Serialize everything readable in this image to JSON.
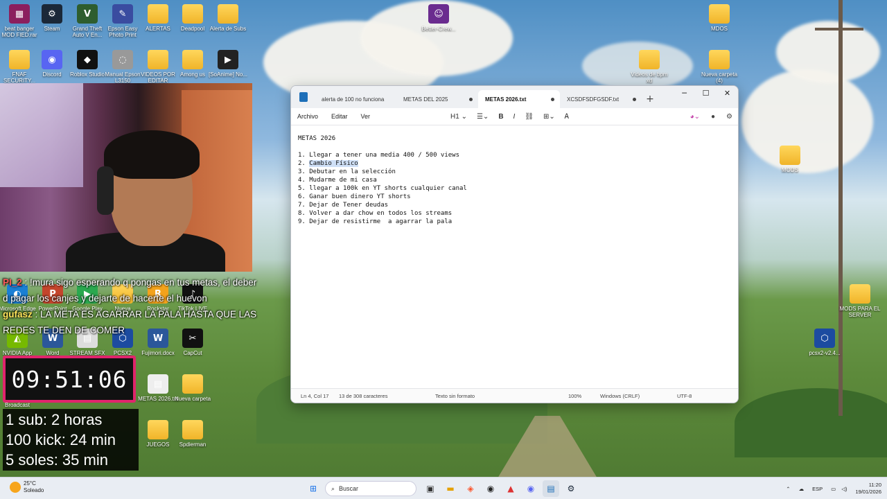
{
  "desktop_icons": [
    {
      "id": "beat-banger",
      "label": "beat banger MOD FIED.rar",
      "color": "#8b1f5e",
      "glyph": "▦"
    },
    {
      "id": "steam",
      "label": "Steam",
      "color": "#1b2838",
      "glyph": "⚙"
    },
    {
      "id": "gta",
      "label": "Grand Theft Auto V En...",
      "color": "#2e5d2e",
      "glyph": "V"
    },
    {
      "id": "epson",
      "label": "Epson Easy Photo Print",
      "color": "#3a4ca0",
      "glyph": "✎"
    },
    {
      "id": "alertas",
      "label": "ALERTAS",
      "color": "folder",
      "glyph": ""
    },
    {
      "id": "deadpool",
      "label": "Deadpool",
      "color": "folder",
      "glyph": ""
    },
    {
      "id": "alerta-subs",
      "label": "Alerta de Subs",
      "color": "folder",
      "glyph": ""
    },
    {
      "id": "better-crew",
      "label": "Better-Crew...",
      "color": "#6a2c8f",
      "glyph": "☺"
    },
    {
      "id": "mdos",
      "label": "MDOS",
      "color": "folder",
      "glyph": ""
    },
    {
      "id": "fnaf",
      "label": "FNAF SECURITY...",
      "color": "folder",
      "glyph": ""
    },
    {
      "id": "discord",
      "label": "Discord",
      "color": "#5865f2",
      "glyph": "◉"
    },
    {
      "id": "roblox",
      "label": "Roblox Studio",
      "color": "#111",
      "glyph": "◆"
    },
    {
      "id": "manual",
      "label": "Manual Epson L3150",
      "color": "#999",
      "glyph": "◌"
    },
    {
      "id": "videos-por-editar",
      "label": "VIDEOS POR EDITAR",
      "color": "folder",
      "glyph": ""
    },
    {
      "id": "among-us",
      "label": "Among us",
      "color": "folder",
      "glyph": ""
    },
    {
      "id": "soanime",
      "label": "[SoAnime] No...",
      "color": "#222",
      "glyph": "▶"
    },
    {
      "id": "videos-bpm",
      "label": "Videos de bpm xd",
      "color": "folder",
      "glyph": ""
    },
    {
      "id": "nueva-carpeta-4",
      "label": "Nueva carpeta (4)",
      "color": "folder",
      "glyph": ""
    },
    {
      "id": "mods",
      "label": "MODS",
      "color": "folder",
      "glyph": ""
    },
    {
      "id": "microsoft-edge",
      "label": "Microsoft Edge",
      "color": "#1a7fd4",
      "glyph": "◐"
    },
    {
      "id": "powerpoint",
      "label": "PowerPoint",
      "color": "#c4452c",
      "glyph": "P"
    },
    {
      "id": "google-play",
      "label": "Google Play",
      "color": "#2aa84f",
      "glyph": "▶"
    },
    {
      "id": "nueva",
      "label": "Nueva",
      "color": "folder",
      "glyph": ""
    },
    {
      "id": "rockstar",
      "label": "Rockstar",
      "color": "#f3a21b",
      "glyph": "R"
    },
    {
      "id": "tiktok-live",
      "label": "TikTok LIVE",
      "color": "#111",
      "glyph": "♪"
    },
    {
      "id": "mods-server",
      "label": "MODS PARA EL SERVER",
      "color": "folder",
      "glyph": ""
    },
    {
      "id": "nvidia-app",
      "label": "NVIDIA App",
      "color": "#76b900",
      "glyph": "◭"
    },
    {
      "id": "word",
      "label": "Word",
      "color": "#2b579a",
      "glyph": "W"
    },
    {
      "id": "stream-sfx",
      "label": "STREAM SFX",
      "color": "#ddd",
      "glyph": "▤"
    },
    {
      "id": "pcsx2",
      "label": "PCSX2",
      "color": "#1c4ba0",
      "glyph": "⬡"
    },
    {
      "id": "fujimori",
      "label": "Fujimori.docx",
      "color": "#2b579a",
      "glyph": "W"
    },
    {
      "id": "capcut",
      "label": "CapCut",
      "color": "#111",
      "glyph": "✂"
    },
    {
      "id": "pcsx2-v2",
      "label": "pcsx2-v2.4...",
      "color": "#1c4ba0",
      "glyph": "⬡"
    },
    {
      "id": "nvidia-broadcast",
      "label": "NVIDIA Broadcast",
      "color": "#76b900",
      "glyph": "◭"
    },
    {
      "id": "metas-2026",
      "label": "METAS 2026.txt",
      "color": "#eee",
      "glyph": "▤"
    },
    {
      "id": "nueva-carpeta",
      "label": "Nueva carpeta",
      "color": "folder",
      "glyph": ""
    },
    {
      "id": "juegos",
      "label": "JUEGOS",
      "color": "folder",
      "glyph": ""
    },
    {
      "id": "spdierman",
      "label": "Spdierman",
      "color": "folder",
      "glyph": ""
    }
  ],
  "chat": {
    "line1_user": "PI_2",
    "line1_text": "!mura sigo esperando q pongas en tus metas, el deber d pagar los canjes y dejarte de hacerte el huevon",
    "line2_user": "gufasz",
    "line2_text": "LA META ES AGARRAR LA PALA HASTA QUE LAS REDES TE DEN DE COMER"
  },
  "timer": {
    "value": "09:51:06"
  },
  "goals": [
    "1 sub: 2 horas",
    "100 kick: 24 min",
    "5 soles: 35 min"
  ],
  "notepad": {
    "tabs": [
      {
        "label": "alerta de 100 no funciona",
        "active": false
      },
      {
        "label": "METAS DEL 2025",
        "active": false
      },
      {
        "label": "METAS 2026.txt",
        "active": true
      },
      {
        "label": "XCSDFSDFGSDF.txt",
        "active": false
      }
    ],
    "menu": [
      "Archivo",
      "Editar",
      "Ver"
    ],
    "heading_selector": "H1",
    "content": {
      "title": "METAS 2026",
      "items": [
        "1. Llegar a tener una media 400 / 500 views",
        "2. Cambio Físico",
        "3. Debutar en la selección",
        "4. Mudarme de mi casa",
        "5. llegar a 100k en YT shorts cualquier canal",
        "6. Ganar buen dinero YT shorts",
        "7. Dejar de Tener deudas",
        "8. Volver a dar chow en todos los streams",
        "9. Dejar de resistirme  a agarrar la pala"
      ]
    },
    "status": {
      "position": "Ln 4, Col 17",
      "selection": "13 de 308 caracteres",
      "format": "Texto sin formato",
      "zoom": "100%",
      "line_endings": "Windows (CRLF)",
      "encoding": "UTF-8"
    }
  },
  "taskbar": {
    "weather_temp": "25°C",
    "weather_desc": "Soleado",
    "search_placeholder": "Buscar",
    "language": "ESP",
    "time": "11:20",
    "date": "19/01/2026"
  }
}
